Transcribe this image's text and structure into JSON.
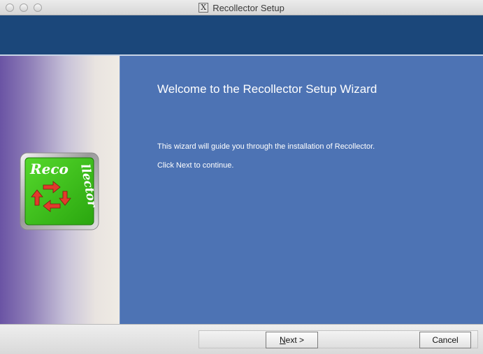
{
  "window": {
    "title": "Recollector Setup",
    "title_icon_glyph": "X"
  },
  "logo": {
    "text_top": "Reco",
    "text_side": "llector",
    "tile_color": "#3cc21e",
    "arrow_color": "#e23a2c"
  },
  "content": {
    "heading": "Welcome to the Recollector Setup Wizard",
    "paragraph_1": "This wizard will guide you through the installation of Recollector.",
    "paragraph_2": "Click Next to continue."
  },
  "buttons": {
    "next_label": "Next >",
    "cancel_label": "Cancel"
  },
  "colors": {
    "header_band": "#1b477a",
    "content_bg": "#4d73b4"
  }
}
